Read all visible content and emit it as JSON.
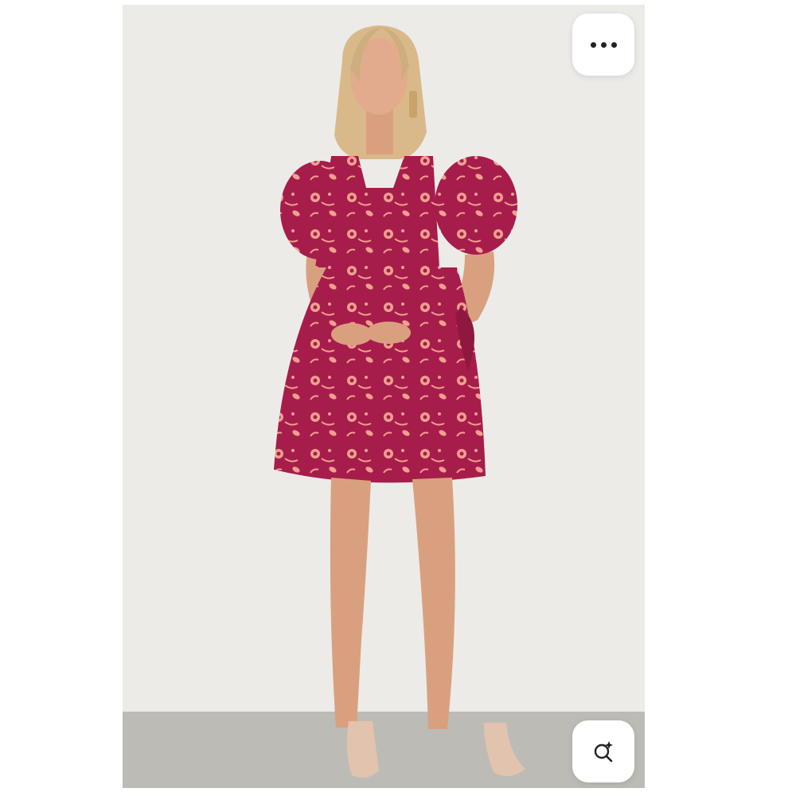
{
  "viewer": {
    "image_subject": "product-photo",
    "more_button_icon": "more-horizontal-icon",
    "lens_button_icon": "visual-search-icon"
  },
  "colors": {
    "background": "#ffffff",
    "photo_backdrop": "#ecebe8",
    "floor": "#bdbbb6",
    "dress": "#a61d4b",
    "print": "#f1a08e",
    "skin": "#d9a080",
    "hair": "#d9b98a"
  }
}
